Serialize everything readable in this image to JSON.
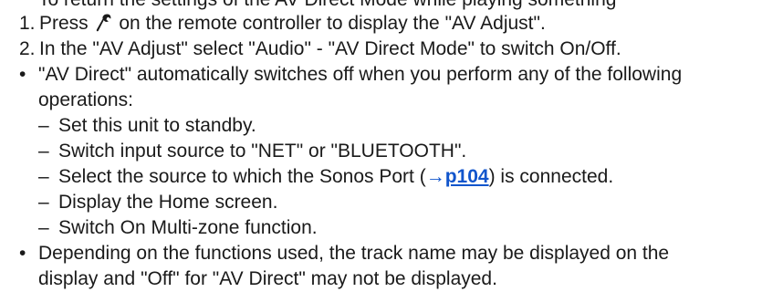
{
  "intro_cut": "To return the settings of the AV Direct Mode while playing something",
  "steps": [
    {
      "number": "1.",
      "before": "Press",
      "icon": "wrench-icon",
      "after": "on the remote controller to display the \"AV Adjust\"."
    },
    {
      "number": "2.",
      "text": "In the \"AV Adjust\" select \"Audio\" - \"AV Direct Mode\" to switch On/Off."
    }
  ],
  "bullets": [
    {
      "lines": [
        "\"AV Direct\" automatically switches off when you perform any of the following",
        "operations:"
      ],
      "subitems": [
        "Set this unit to standby.",
        "Switch input source to \"NET\" or \"BLUETOOTH\".",
        {
          "before": "Select the source to which the Sonos Port (",
          "arrow": "→",
          "page": "p104",
          "after": ") is connected."
        },
        "Display the Home screen.",
        "Switch On Multi-zone function."
      ]
    },
    {
      "lines": [
        "Depending on the functions used, the track name may be displayed on the",
        "display and \"Off\" for \"AV Direct\" may not be displayed."
      ]
    }
  ],
  "symbols": {
    "bullet": "•",
    "dash": "–"
  },
  "colors": {
    "text": "#1a1a1a",
    "link": "#1155cc"
  }
}
